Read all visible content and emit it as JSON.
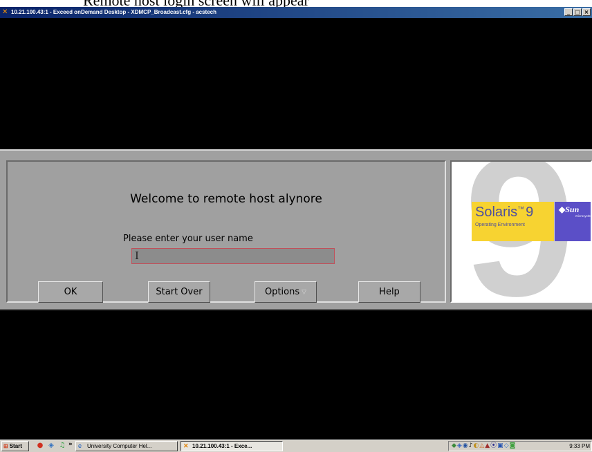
{
  "caption": "Remote host login screen will appear",
  "window": {
    "title": "10.21.100.43:1 - Exceed onDemand Desktop - XDMCP_Broadcast.cfg - acstech",
    "icon": "exceed-x-icon",
    "minimize": "_",
    "maximize": "□",
    "close": "×"
  },
  "login": {
    "welcome": "Welcome to remote host alynore",
    "prompt": "Please enter your user name",
    "username_value": "",
    "buttons": {
      "ok": "OK",
      "start_over": "Start Over",
      "options": "Options",
      "help": "Help"
    }
  },
  "logo": {
    "big_digit": "9",
    "product": "Solaris",
    "version": "9",
    "subtitle": "Operating Environment",
    "vendor": "Sun",
    "vendor_tag": "microsystems",
    "colors": {
      "yellow": "#f7d331",
      "purple": "#5b4fc7",
      "text": "#4d4f9e"
    }
  },
  "taskbar": {
    "start": "Start",
    "quick_launch": [
      "firefox-icon",
      "network-icon",
      "media-icon"
    ],
    "chevron": "»",
    "tasks": [
      {
        "label": "University Computer Hel...",
        "icon": "ie-icon",
        "active": false
      },
      {
        "label": "10.21.100.43:1 - Exce...",
        "icon": "exceed-icon",
        "active": true
      }
    ],
    "tray_icons": [
      "tray-icon-1",
      "tray-icon-2",
      "tray-icon-3",
      "volume-icon",
      "tray-icon-5",
      "tray-icon-6",
      "tray-icon-7",
      "tray-icon-8",
      "tray-icon-9",
      "tray-icon-10",
      "tray-icon-11"
    ],
    "clock": "9:33 PM"
  }
}
